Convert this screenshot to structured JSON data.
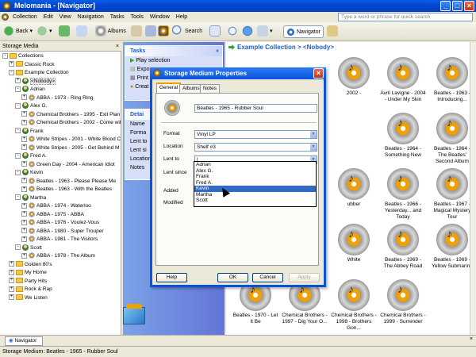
{
  "window": {
    "title": "Melomania - [Navigator]"
  },
  "menu": [
    "Collection",
    "Edit",
    "View",
    "Navigation",
    "Tasks",
    "Tools",
    "Window",
    "Help"
  ],
  "search": {
    "placeholder": "Type a word or phrase for quick search"
  },
  "toolbar": {
    "back": "Back",
    "albums": "Albums",
    "search": "Search",
    "navigator": "Navigator"
  },
  "sidebar": {
    "header": "Storage Media",
    "items": [
      {
        "label": "Collections",
        "icon": "folder-icon",
        "level": 0,
        "exp": "-"
      },
      {
        "label": "Classic Rock",
        "icon": "folder-icon",
        "level": 1,
        "exp": "+"
      },
      {
        "label": "Example Collection",
        "icon": "folder-icon",
        "level": 1,
        "exp": "-"
      },
      {
        "label": "<Nobody>",
        "icon": "user-icon",
        "level": 2,
        "exp": "+"
      },
      {
        "label": "Adrian",
        "icon": "user-icon",
        "level": 2,
        "exp": "-"
      },
      {
        "label": "ABBA - 1973 - Ring Ring",
        "icon": "disc-icon",
        "level": 3,
        "exp": "+"
      },
      {
        "label": "Alex G.",
        "icon": "user-icon",
        "level": 2,
        "exp": "-"
      },
      {
        "label": "Chemical Brothers - 1995 - Exit Plan",
        "icon": "disc-icon",
        "level": 3,
        "exp": "+"
      },
      {
        "label": "Chemical Brothers - 2002 - Come wit",
        "icon": "disc-icon",
        "level": 3,
        "exp": "+"
      },
      {
        "label": "Frank",
        "icon": "user-icon",
        "level": 2,
        "exp": "-"
      },
      {
        "label": "White Stripes - 2001 - White Blood C",
        "icon": "disc-icon",
        "level": 3,
        "exp": "+"
      },
      {
        "label": "White Stripes - 2005 - Get Behind M",
        "icon": "disc-icon",
        "level": 3,
        "exp": "+"
      },
      {
        "label": "Fred A.",
        "icon": "user-icon",
        "level": 2,
        "exp": "-"
      },
      {
        "label": "Green Day - 2004 - American Idiot",
        "icon": "disc-icon",
        "level": 3,
        "exp": "+"
      },
      {
        "label": "Kevin",
        "icon": "user-icon",
        "level": 2,
        "exp": "-"
      },
      {
        "label": "Beatles - 1963 - Please Please Me",
        "icon": "disc-icon",
        "level": 3,
        "exp": "+"
      },
      {
        "label": "Beatles - 1963 - With the Beatles",
        "icon": "disc-icon",
        "level": 3,
        "exp": "+"
      },
      {
        "label": "Martha",
        "icon": "user-icon",
        "level": 2,
        "exp": "-"
      },
      {
        "label": "ABBA - 1974 - Waterloo",
        "icon": "disc-icon",
        "level": 3,
        "exp": "+"
      },
      {
        "label": "ABBA - 1975 - ABBA",
        "icon": "disc-icon",
        "level": 3,
        "exp": "+"
      },
      {
        "label": "ABBA - 1976 - Voulez-Vous",
        "icon": "disc-icon",
        "level": 3,
        "exp": "+"
      },
      {
        "label": "ABBA - 1980 - Super Trouper",
        "icon": "disc-icon",
        "level": 3,
        "exp": "+"
      },
      {
        "label": "ABBA - 1981 - The Visitors",
        "icon": "disc-icon",
        "level": 3,
        "exp": "+"
      },
      {
        "label": "Scott",
        "icon": "user-icon",
        "level": 2,
        "exp": "-"
      },
      {
        "label": "ABBA - 1978 - The Album",
        "icon": "disc-icon",
        "level": 3,
        "exp": "+"
      },
      {
        "label": "Golden 80's",
        "icon": "folder-icon",
        "level": 1,
        "exp": "+"
      },
      {
        "label": "My Home",
        "icon": "folder-icon",
        "level": 1,
        "exp": "+"
      },
      {
        "label": "Party Hits",
        "icon": "folder-icon",
        "level": 1,
        "exp": "+"
      },
      {
        "label": "Rock & Rap",
        "icon": "folder-icon",
        "level": 1,
        "exp": "+"
      },
      {
        "label": "We Listen",
        "icon": "folder-icon",
        "level": 1,
        "exp": "+"
      }
    ]
  },
  "tasks": {
    "title": "Tasks",
    "items": [
      "Play selection",
      "Expo",
      "Print s",
      "Creat"
    ],
    "details_title": "Detai",
    "details": [
      "Name",
      "Forma",
      "Lent to",
      "Lent si",
      "Location",
      "Notes"
    ]
  },
  "main": {
    "breadcrumb": "Example Collection > <Nobody>",
    "cards": [
      {
        "label": "2002 -",
        "col": 2,
        "row": 0
      },
      {
        "label": "Avril Lavigne - 2004 - Under My Skin",
        "col": 3,
        "row": 0
      },
      {
        "label": "Beatles - 1963 - Introducing...",
        "col": 4,
        "row": 0
      },
      {
        "label": "Beatles - 1964 - Something New",
        "col": 3,
        "row": 1
      },
      {
        "label": "Beatles - 1964 - The Beatles' Second Album",
        "col": 4,
        "row": 1
      },
      {
        "label": "ubber",
        "col": 2,
        "row": 2
      },
      {
        "label": "Beatles - 1966 - Yesterday... and Today",
        "col": 3,
        "row": 2
      },
      {
        "label": "Beatles - 1967 - Magical Mystery Tour",
        "col": 4,
        "row": 2
      },
      {
        "label": "White",
        "col": 2,
        "row": 3
      },
      {
        "label": "Beatles - 1969 - The Abbey Road",
        "col": 3,
        "row": 3
      },
      {
        "label": "Beatles - 1969 - Yellow Submarine",
        "col": 4,
        "row": 3
      },
      {
        "label": "Beatles - 1970 - Let It Be",
        "col": 0,
        "row": 4
      },
      {
        "label": "Chemical Brothers - 1997 - Dig Your O...",
        "col": 1,
        "row": 4
      },
      {
        "label": "Chemical Brothers - 1998 - Brothers Gon...",
        "col": 2,
        "row": 4
      },
      {
        "label": "Chemical Brothers - 1999 - Surrender",
        "col": 3,
        "row": 4
      }
    ]
  },
  "dialog": {
    "title": "Storage Medium Properties",
    "tabs": [
      "General",
      "Albums",
      "Notes"
    ],
    "name": "Beatles - 1965 - Rubber Soul",
    "format_label": "Format",
    "format_value": "Vinyl LP",
    "location_label": "Location",
    "location_value": "Shelf #3",
    "lentto_label": "Lent to",
    "lentto_value": "|",
    "lentsince_label": "Lent since",
    "added_label": "Added",
    "modified_label": "Modified",
    "dropdown_options": [
      "Adrian",
      "Alex G.",
      "Frank",
      "Fred A.",
      "Kevin",
      "Martha",
      "Scott"
    ],
    "dropdown_selected": "Kevin",
    "buttons": {
      "help": "Help",
      "ok": "OK",
      "cancel": "Cancel",
      "apply": "Apply"
    }
  },
  "tabbar": {
    "tab": "Navigator"
  },
  "status": "Storage Medium: Beatles - 1965 - Rubber Soul",
  "colors": {
    "titlebar": "#0048d0",
    "accent": "#f0a000",
    "selection": "#316ac5",
    "link": "#215dc6"
  }
}
